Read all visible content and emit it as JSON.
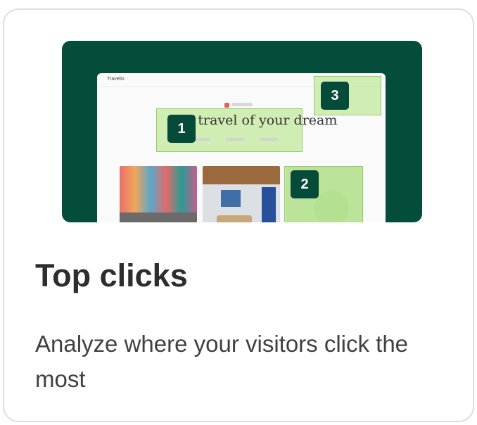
{
  "card": {
    "title": "Top clicks",
    "description": "Analyze where your visitors click the most"
  },
  "preview": {
    "brand": "Travelio",
    "headline": "a travel of your dream",
    "hotspots": [
      {
        "label": "1"
      },
      {
        "label": "2"
      },
      {
        "label": "3"
      }
    ],
    "colors": {
      "hero_background": "#034d3a",
      "badge": "#064a39",
      "hotspot": "#bee896"
    }
  }
}
